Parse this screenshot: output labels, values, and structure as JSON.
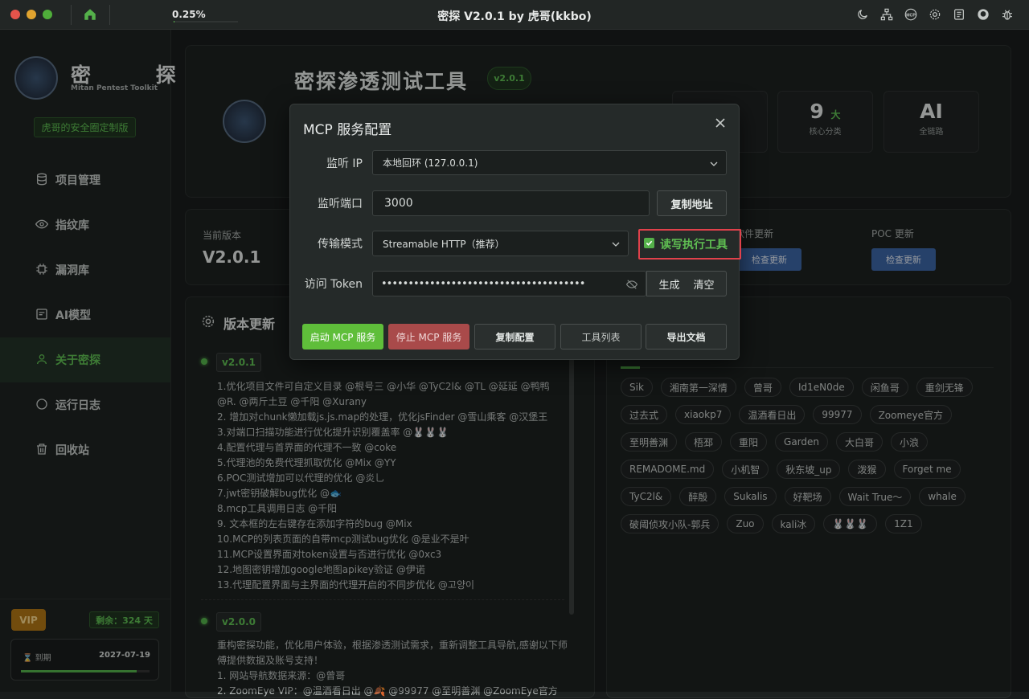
{
  "window": {
    "title": "密探 V2.0.1 by 虎哥(kkbo)",
    "progress_text": "0.25%",
    "progress": 0.25
  },
  "colors": {
    "accent": "#54b04a",
    "danger": "#d9534f",
    "link_button": "#3b64a3",
    "vip": "#b07614",
    "highlight_box": "#e0414b"
  },
  "toolbar_icons": [
    "moon-icon",
    "network-icon",
    "mcp-icon",
    "gear-icon",
    "document-icon",
    "github-icon",
    "bug-icon"
  ],
  "sidebar": {
    "brand": "密 探",
    "brand_sub": "Mitan Pentest Toolkit",
    "tagline": "虎哥的安全圈定制版",
    "items": [
      {
        "label": "项目管理",
        "icon": "database-icon"
      },
      {
        "label": "指纹库",
        "icon": "eye-icon"
      },
      {
        "label": "漏洞库",
        "icon": "chip-icon"
      },
      {
        "label": "AI模型",
        "icon": "ai-icon"
      },
      {
        "label": "关于密探",
        "icon": "user-icon"
      },
      {
        "label": "运行日志",
        "icon": "chat-icon"
      },
      {
        "label": "回收站",
        "icon": "trash-icon"
      }
    ],
    "vip": "VIP",
    "remain": "剩余：324 天",
    "expire_label": "⌛ 到期",
    "expire_date": "2027-07-19",
    "expire_progress": 0.9
  },
  "hero": {
    "title": "密探渗透测试工具",
    "version": "v2.0.1",
    "stats": [
      {
        "num": "9",
        "unit": "大",
        "label": "核心分类"
      },
      {
        "num": "AI",
        "unit": "",
        "label": "全链路"
      }
    ]
  },
  "version_panel": {
    "current_label": "当前版本",
    "current_value": "V2.0.1",
    "soft_update_label": "软件更新",
    "poc_update_label": "POC 更新",
    "check_button": "检查更新"
  },
  "changelog": {
    "title": "版本更新",
    "v1": {
      "version": "v2.0.1",
      "lines": [
        "1.优化项目文件可自定义目录 @根号三 @小华 @TyC2l& @TL @延延 @鸭鸭 @R. @两斤土豆 @千阳 @Xurany",
        "2. 增加对chunk懒加载js.js.map的处理，优化jsFinder @雪山乘客 @汉堡王",
        "3.对端口扫描功能进行优化提升识别覆盖率 @🐰🐰🐰",
        "4.配置代理与首界面的代理不一致 @coke",
        "5.代理池的免费代理抓取优化 @Mix @YY",
        "6.POC测试增加可以代理的优化 @炎乚",
        "7.jwt密钥破解bug优化 @🐟",
        "8.mcp工具调用日志 @千阳",
        "9. 文本框的左右键存在添加字符的bug @Mix",
        "10.MCP的列表页面的自带mcp测试bug优化 @是业不是叶",
        "11.MCP设置界面对token设置与否进行优化 @0xc3",
        "12.地图密钥增加google地图apikey验证 @伊诺",
        "13.代理配置界面与主界面的代理开启的不同步优化 @고양이"
      ]
    },
    "v2": {
      "version": "v2.0.0",
      "lines": [
        "重构密探功能，优化用户体验，根据渗透测试需求，重新调整工具导航,感谢以下师傅提供数据及账号支持！",
        "1. 网站导航数据来源：@曾哥",
        "2. ZoomEye VIP：@温酒看日出 @🍂 @99977 @至明善渊 @ZoomEye官方"
      ]
    }
  },
  "thanks_tags": [
    "Sik",
    "湘南第一深情",
    "曾哥",
    "Id1eN0de",
    "闲鱼哥",
    "重剑无锋",
    "过去式",
    "xiaokp7",
    "温酒看日出",
    "99977",
    "Zoomeye官方",
    "至明善渊",
    "梧邳",
    "重阳",
    "Garden",
    "大白哥",
    "小浪",
    "REMADOME.md",
    "小机智",
    "秋东坡_up",
    "泼猴",
    "Forget me",
    "TyC2l&",
    "醉殷",
    "Sukalis",
    "好靶场",
    "Wait True～",
    "whale",
    "破阈侦攻小队-郭兵",
    "Zuo",
    "kali冰",
    "🐰🐰🐰",
    "1Z1"
  ],
  "modal": {
    "title": "MCP 服务配置",
    "ip_label": "监听 IP",
    "ip_value": "本地回环 (127.0.0.1)",
    "port_label": "监听端口",
    "port_value": "3000",
    "copy_addr": "复制地址",
    "mode_label": "传输模式",
    "mode_value": "Streamable HTTP（推荐）",
    "rw_label": "读写执行工具",
    "rw_checked": true,
    "token_label": "访问 Token",
    "token_value": "••••••••••••••••••••••••••••••••••••••",
    "gen": "生成",
    "clear": "清空",
    "btn_start": "启动 MCP 服务",
    "btn_stop": "停止 MCP 服务",
    "btn_copy": "复制配置",
    "btn_tools": "工具列表",
    "btn_export": "导出文档"
  }
}
